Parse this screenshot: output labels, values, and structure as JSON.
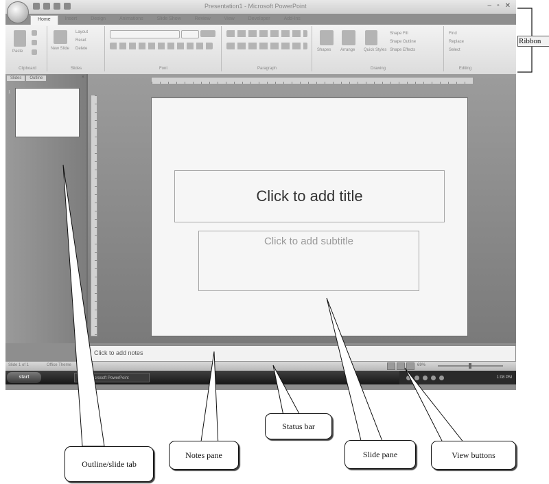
{
  "window": {
    "title": "Presentation1 - Microsoft PowerPoint",
    "controls": [
      "–",
      "▫",
      "✕"
    ]
  },
  "ribbon_tabs": [
    "Home",
    "Insert",
    "Design",
    "Animations",
    "Slide Show",
    "Review",
    "View",
    "Developer",
    "Add-Ins"
  ],
  "ribbon_groups": {
    "clipboard": {
      "label": "Clipboard",
      "paste": "Paste"
    },
    "slides": {
      "label": "Slides",
      "new_slide": "New Slide",
      "layout": "Layout",
      "reset": "Reset",
      "delete": "Delete"
    },
    "font": {
      "label": "Font"
    },
    "paragraph": {
      "label": "Paragraph"
    },
    "drawing": {
      "label": "Drawing",
      "shapes": "Shapes",
      "arrange": "Arrange",
      "quick_styles": "Quick Styles",
      "shape_fill": "Shape Fill",
      "shape_outline": "Shape Outline",
      "shape_effects": "Shape Effects"
    },
    "editing": {
      "label": "Editing",
      "find": "Find",
      "replace": "Replace",
      "select": "Select"
    }
  },
  "outline_pane": {
    "tabs": [
      "Slides",
      "Outline"
    ],
    "close": "×",
    "thumbnail_number": "1"
  },
  "slide": {
    "title_placeholder": "Click to add title",
    "subtitle_placeholder": "Click to add subtitle"
  },
  "notes_pane": {
    "placeholder": "Click to add notes"
  },
  "status_bar": {
    "slide_info": "Slide 1 of 1",
    "theme": "Office Theme",
    "zoom": "69%"
  },
  "taskbar": {
    "start": "start",
    "task": "Microsoft PowerPoint",
    "clock": "1:08 PM"
  },
  "annotations": {
    "ribbon": "Ribbon",
    "outline_slide_tab": "Outline/slide tab",
    "notes_pane": "Notes pane",
    "status_bar": "Status bar",
    "slide_pane": "Slide pane",
    "view_buttons": "View buttons"
  }
}
